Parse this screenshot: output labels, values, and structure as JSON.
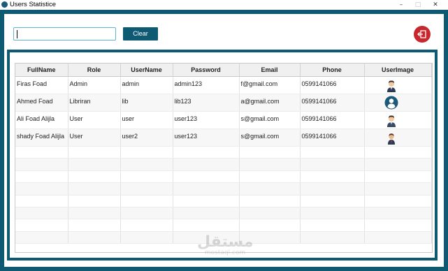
{
  "window": {
    "title": "Users Statistice",
    "controls": [
      "–",
      "□",
      "✕"
    ]
  },
  "toolbar": {
    "search_value": "",
    "clear_label": "Clear",
    "logout_icon": "logout-icon"
  },
  "table": {
    "columns": [
      "FullName",
      "Role",
      "UserName",
      "Password",
      "Email",
      "Phone",
      "UserImage"
    ],
    "rows": [
      {
        "fullname": "Firas Foad",
        "role": "Admin",
        "username": "admin",
        "password": "admin123",
        "email": "f@gmail.com",
        "phone": "0599141066",
        "image": "man-in-suit-avatar"
      },
      {
        "fullname": "Ahmed Foad",
        "role": "Libriran",
        "username": "lib",
        "password": "lib123",
        "email": "a@gmail.com",
        "phone": "0599141066",
        "image": "round-blue-user-avatar"
      },
      {
        "fullname": "Ali Foad Alijla",
        "role": "User",
        "username": "user",
        "password": "user123",
        "email": "s@gmail.com",
        "phone": "0599141066",
        "image": "man-in-suit-avatar"
      },
      {
        "fullname": "shady Foad Alijla",
        "role": "User",
        "username": "user2",
        "password": "user123",
        "email": "s@gmail.com",
        "phone": "0599141066",
        "image": "man-red-tie-avatar"
      }
    ],
    "empty_row_count": 8
  },
  "watermark": {
    "arabic": "مستقل",
    "latin": "mostaql.com"
  },
  "colors": {
    "frame": "#0e5a73",
    "button": "#0e5a73",
    "logout": "#c8282d"
  }
}
